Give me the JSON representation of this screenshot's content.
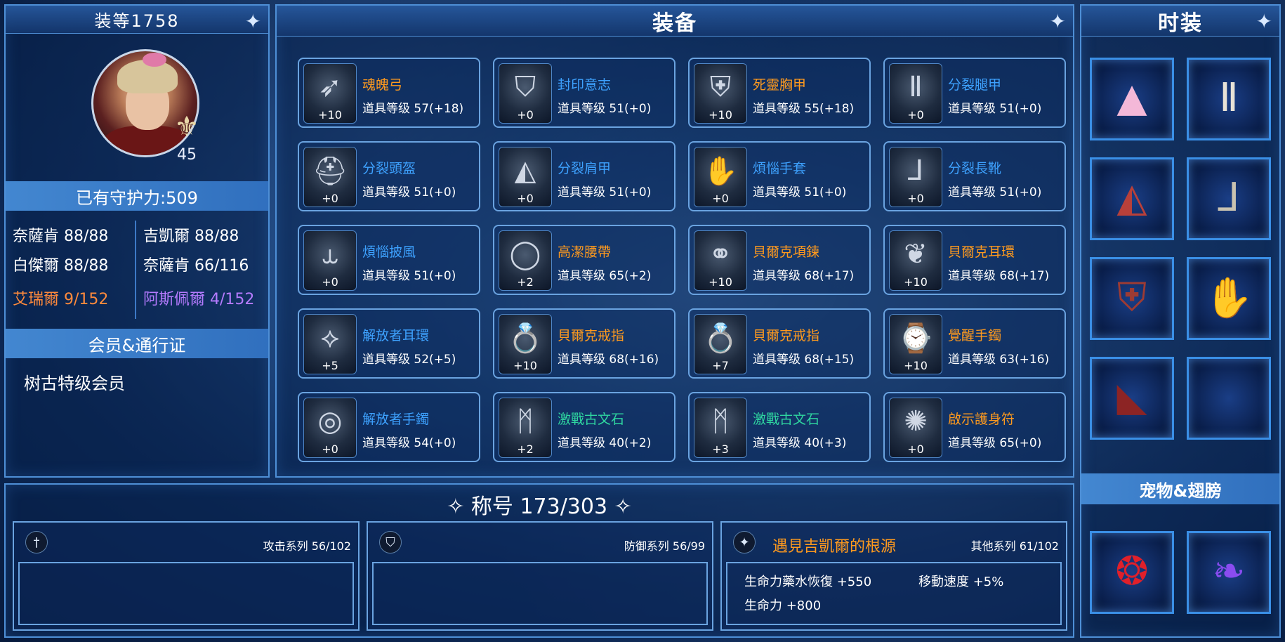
{
  "left": {
    "gear_score": "装等1758",
    "level": "45",
    "guard_power": "已有守护力:509",
    "stats": [
      {
        "text": "奈薩肯 88/88",
        "color": "white"
      },
      {
        "text": "吉凱爾 88/88",
        "color": "white"
      },
      {
        "text": "白傑爾 88/88",
        "color": "white"
      },
      {
        "text": "奈薩肯 66/116",
        "color": "white"
      },
      {
        "text": "艾瑞爾 9/152",
        "color": "orange"
      },
      {
        "text": "阿斯佩爾 4/152",
        "color": "purple"
      }
    ],
    "membership_title": "会员&通行证",
    "membership_value": "树古特级会员"
  },
  "equipment": {
    "title": "装备",
    "items": [
      {
        "name": "魂魄弓",
        "stat": "道具等级 57(+18)",
        "enh": "+10",
        "rarity": "orange",
        "icon": "bow-icon",
        "glyph": "➶"
      },
      {
        "name": "封印意志",
        "stat": "道具等级 51(+0)",
        "enh": "+0",
        "rarity": "blue",
        "icon": "shield-icon",
        "glyph": "⛉"
      },
      {
        "name": "死靈胸甲",
        "stat": "道具等级 55(+18)",
        "enh": "+10",
        "rarity": "orange",
        "icon": "chest-armor-icon",
        "glyph": "⛨"
      },
      {
        "name": "分裂腿甲",
        "stat": "道具等级 51(+0)",
        "enh": "+0",
        "rarity": "blue",
        "icon": "leg-armor-icon",
        "glyph": "Ⅱ"
      },
      {
        "name": "分裂頭盔",
        "stat": "道具等级 51(+0)",
        "enh": "+0",
        "rarity": "blue",
        "icon": "helmet-icon",
        "glyph": "⛑"
      },
      {
        "name": "分裂肩甲",
        "stat": "道具等级 51(+0)",
        "enh": "+0",
        "rarity": "blue",
        "icon": "shoulder-armor-icon",
        "glyph": "◭"
      },
      {
        "name": "煩惱手套",
        "stat": "道具等级 51(+0)",
        "enh": "+0",
        "rarity": "blue",
        "icon": "gloves-icon",
        "glyph": "✋"
      },
      {
        "name": "分裂長靴",
        "stat": "道具等级 51(+0)",
        "enh": "+0",
        "rarity": "blue",
        "icon": "boots-icon",
        "glyph": "⅃"
      },
      {
        "name": "煩惱披風",
        "stat": "道具等级 51(+0)",
        "enh": "+0",
        "rarity": "blue",
        "icon": "cape-icon",
        "glyph": "⥿"
      },
      {
        "name": "高潔腰帶",
        "stat": "道具等级 65(+2)",
        "enh": "+2",
        "rarity": "orange",
        "icon": "belt-icon",
        "glyph": "◯"
      },
      {
        "name": "貝爾克項鍊",
        "stat": "道具等级 68(+17)",
        "enh": "+10",
        "rarity": "orange",
        "icon": "necklace-icon",
        "glyph": "⚭"
      },
      {
        "name": "貝爾克耳環",
        "stat": "道具等级 68(+17)",
        "enh": "+10",
        "rarity": "orange",
        "icon": "earring-icon",
        "glyph": "❦"
      },
      {
        "name": "解放者耳環",
        "stat": "道具等级 52(+5)",
        "enh": "+5",
        "rarity": "blue",
        "icon": "earring-icon",
        "glyph": "⟡"
      },
      {
        "name": "貝爾克戒指",
        "stat": "道具等级 68(+16)",
        "enh": "+10",
        "rarity": "orange",
        "icon": "ring-icon",
        "glyph": "💍"
      },
      {
        "name": "貝爾克戒指",
        "stat": "道具等级 68(+15)",
        "enh": "+7",
        "rarity": "orange",
        "icon": "ring-icon",
        "glyph": "💍"
      },
      {
        "name": "覺醒手鐲",
        "stat": "道具等级 63(+16)",
        "enh": "+10",
        "rarity": "orange",
        "icon": "bracelet-icon",
        "glyph": "⌚"
      },
      {
        "name": "解放者手鐲",
        "stat": "道具等级 54(+0)",
        "enh": "+0",
        "rarity": "blue",
        "icon": "bracelet-icon",
        "glyph": "◎"
      },
      {
        "name": "激戰古文石",
        "stat": "道具等级 40(+2)",
        "enh": "+2",
        "rarity": "green",
        "icon": "runestone-icon",
        "glyph": "ᛗ"
      },
      {
        "name": "激戰古文石",
        "stat": "道具等级 40(+3)",
        "enh": "+3",
        "rarity": "green",
        "icon": "runestone-icon",
        "glyph": "ᛗ"
      },
      {
        "name": "啟示護身符",
        "stat": "道具等级 65(+0)",
        "enh": "+0",
        "rarity": "orange",
        "icon": "amulet-icon",
        "glyph": "✺"
      }
    ]
  },
  "fashion": {
    "title": "时装",
    "slots": [
      {
        "icon": "party-hat-icon",
        "glyph": "▲",
        "color": "#f4b8d8"
      },
      {
        "icon": "pants-icon",
        "glyph": "Ⅱ",
        "color": "#e8e2d6"
      },
      {
        "icon": "hood-icon",
        "glyph": "◭",
        "color": "#b8403a"
      },
      {
        "icon": "boots-icon",
        "glyph": "⅃",
        "color": "#c9c2b0"
      },
      {
        "icon": "robe-icon",
        "glyph": "⛨",
        "color": "#9e3b33"
      },
      {
        "icon": "glove-icon",
        "glyph": "✋",
        "color": "#f0ece0"
      },
      {
        "icon": "cape-icon",
        "glyph": "◣",
        "color": "#8c2424"
      },
      {
        "icon": "empty-slot-icon",
        "glyph": "",
        "color": "#ffffff"
      }
    ],
    "pet_title": "宠物&翅膀",
    "pet_slots": [
      {
        "icon": "pet-icon",
        "glyph": "❂",
        "color": "#e0202a"
      },
      {
        "icon": "wings-icon",
        "glyph": "❧",
        "color": "#8a4cf0"
      }
    ]
  },
  "titles": {
    "heading": "✧ 称号 173/303 ✧",
    "cards": [
      {
        "icon": "sword-icon",
        "glyph": "†",
        "category": "攻击系列 56/102",
        "name": "",
        "effects": []
      },
      {
        "icon": "shield-icon",
        "glyph": "⛉",
        "category": "防御系列 56/99",
        "name": "",
        "effects": []
      },
      {
        "icon": "star-icon",
        "glyph": "✦",
        "category": "其他系列 61/102",
        "name": "遇見吉凱爾的根源",
        "effects": [
          "生命力藥水恢復 +550",
          "移動速度 +5%",
          "生命力 +800"
        ]
      }
    ]
  }
}
